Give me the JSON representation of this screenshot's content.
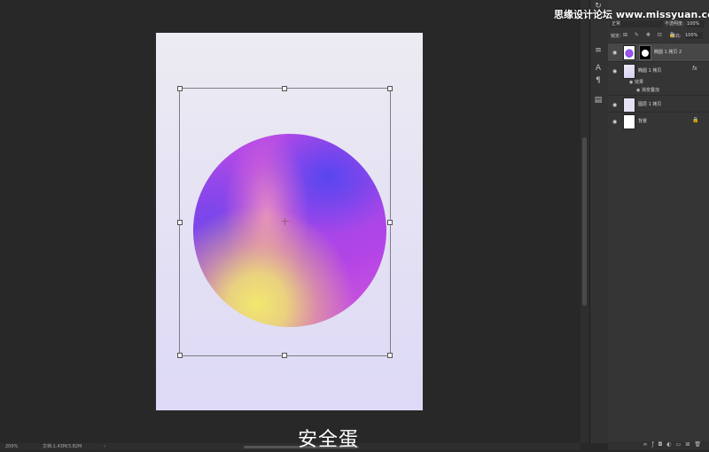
{
  "watermark": "思缘设计论坛 www.missyuan.com",
  "caption": "安全蛋",
  "colors": {
    "workspace": "#282828",
    "panel": "#353535",
    "canvas": "#e6e4f4",
    "circle_yellow": "#f2e86e",
    "circle_blue": "#5046f0",
    "circle_magenta": "#c04ae6"
  },
  "layers_panel": {
    "blend_mode": "正常",
    "opacity_label": "不透明度:",
    "opacity_value": "100%",
    "lock_label": "锁定:",
    "fill_label": "填充:",
    "fill_value": "100%",
    "layers": [
      {
        "name": "椭圆 1 拷贝 2",
        "selected": true,
        "has_mask": true
      },
      {
        "name": "椭圆 1 拷贝",
        "fx": "fx",
        "effects_label": "效果",
        "effect": "渐变叠加"
      },
      {
        "name": "图层 1 拷贝"
      },
      {
        "name": "背景",
        "locked": true
      }
    ],
    "bottom_icons": [
      "link-icon",
      "fx-icon",
      "mask-icon",
      "adjustment-icon",
      "group-icon",
      "new-layer-icon",
      "trash-icon"
    ]
  },
  "status": {
    "zoom": "200%",
    "doc_info": "文档:1.43M/3.82M",
    "arrow": "›"
  },
  "tools_right": [
    "history-icon",
    "adjust-icon",
    "text-icon",
    "paragraph-icon",
    "properties-icon"
  ]
}
